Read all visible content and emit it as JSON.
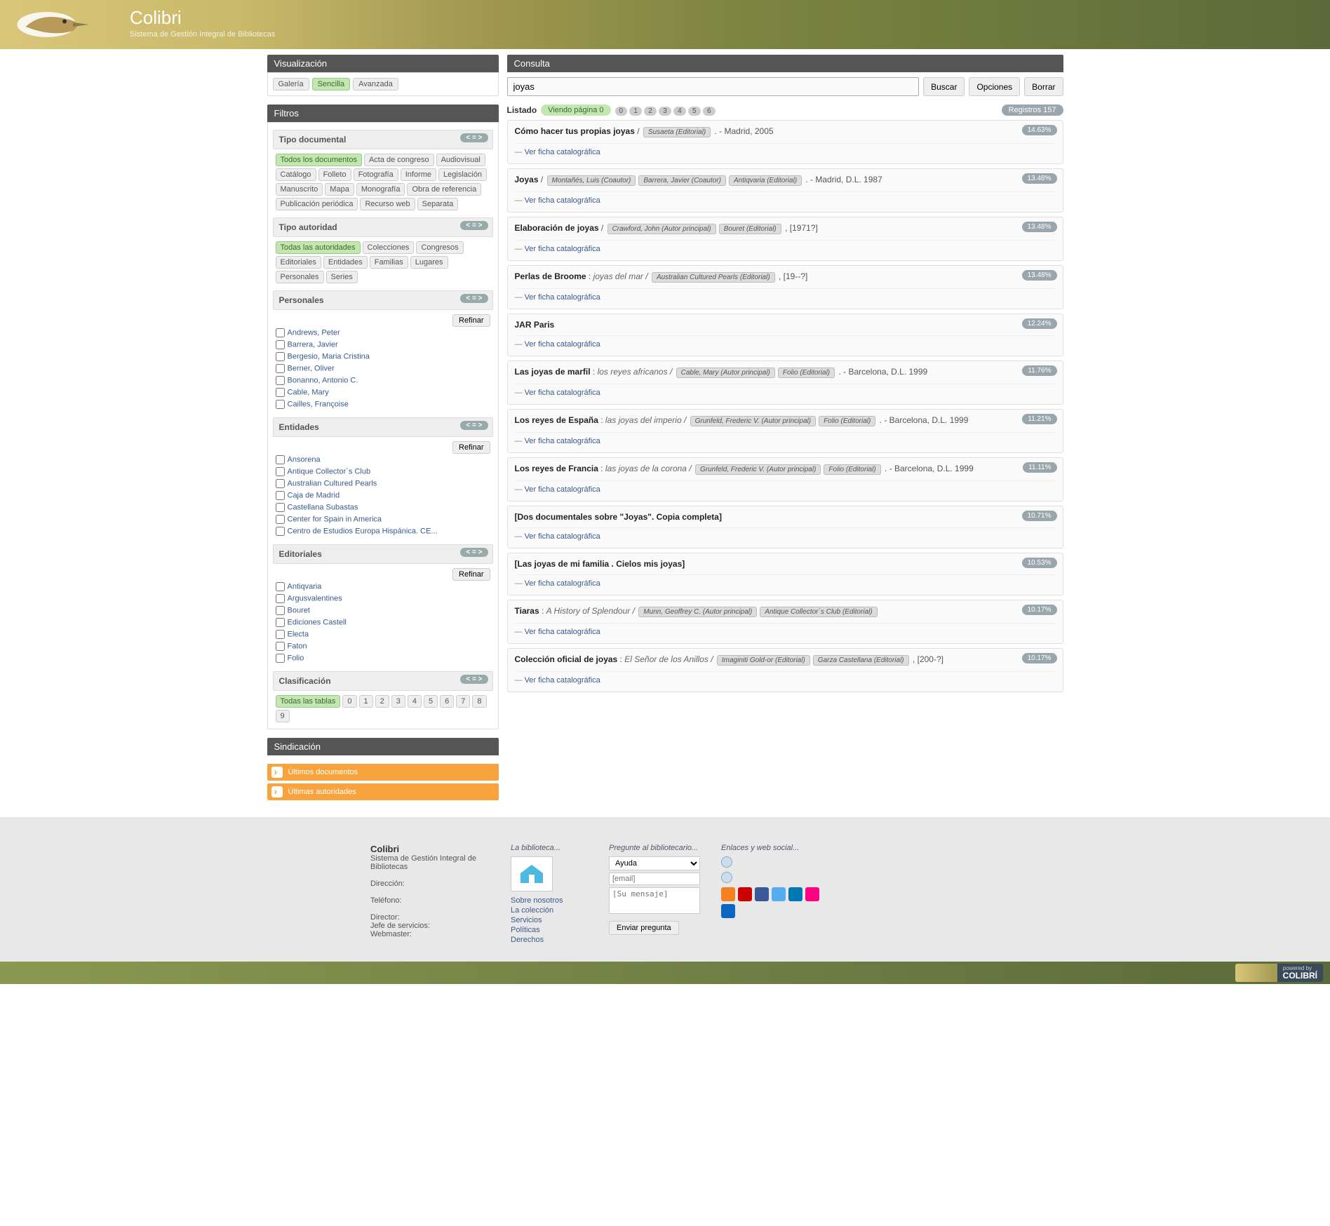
{
  "header": {
    "title": "Colibri",
    "subtitle": "Sistema de Gestión Integral de Bibliotecas"
  },
  "sidebar": {
    "viz": {
      "title": "Visualización",
      "modes": [
        {
          "label": "Galería",
          "active": false
        },
        {
          "label": "Sencilla",
          "active": true
        },
        {
          "label": "Avanzada",
          "active": false
        }
      ]
    },
    "filters_title": "Filtros",
    "doc_type": {
      "title": "Tipo documental",
      "items": [
        {
          "label": "Todos los documentos",
          "active": true
        },
        {
          "label": "Acta de congreso"
        },
        {
          "label": "Audiovisual"
        },
        {
          "label": "Catálogo"
        },
        {
          "label": "Folleto"
        },
        {
          "label": "Fotografía"
        },
        {
          "label": "Informe"
        },
        {
          "label": "Legislación"
        },
        {
          "label": "Manuscrito"
        },
        {
          "label": "Mapa"
        },
        {
          "label": "Monografía"
        },
        {
          "label": "Obra de referencia"
        },
        {
          "label": "Publicación periódica"
        },
        {
          "label": "Recurso web"
        },
        {
          "label": "Separata"
        }
      ]
    },
    "auth_type": {
      "title": "Tipo autoridad",
      "items": [
        {
          "label": "Todas las autoridades",
          "active": true
        },
        {
          "label": "Colecciones"
        },
        {
          "label": "Congresos"
        },
        {
          "label": "Editoriales"
        },
        {
          "label": "Entidades"
        },
        {
          "label": "Familias"
        },
        {
          "label": "Lugares"
        },
        {
          "label": "Personales"
        },
        {
          "label": "Series"
        }
      ]
    },
    "personales": {
      "title": "Personales",
      "refine": "Refinar",
      "items": [
        "Andrews, Peter",
        "Barrera, Javier",
        "Bergesio, Maria Cristina",
        "Berner, Oliver",
        "Bonanno, Antonio C.",
        "Cable, Mary",
        "Cailles, Françoise"
      ]
    },
    "entidades": {
      "title": "Entidades",
      "refine": "Refinar",
      "items": [
        "Ansorena",
        "Antique Collector´s Club",
        "Australian Cultured Pearls",
        "Caja de Madrid",
        "Castellana Subastas",
        "Center for Spain in America",
        "Centro de Estudios Europa Hispánica. CE..."
      ]
    },
    "editoriales": {
      "title": "Editoriales",
      "refine": "Refinar",
      "items": [
        "Antiqvaria",
        "Argusvalentines",
        "Bouret",
        "Ediciones Castell",
        "Electa",
        "Faton",
        "Folio"
      ]
    },
    "clasif": {
      "title": "Clasificación",
      "items": [
        {
          "label": "Todas las tablas",
          "active": true
        },
        {
          "label": "0"
        },
        {
          "label": "1"
        },
        {
          "label": "2"
        },
        {
          "label": "3"
        },
        {
          "label": "4"
        },
        {
          "label": "5"
        },
        {
          "label": "6"
        },
        {
          "label": "7"
        },
        {
          "label": "8"
        },
        {
          "label": "9"
        }
      ]
    },
    "synd": {
      "title": "Sindicación",
      "links": [
        "Últimos documentos",
        "Últimas autoridades"
      ]
    }
  },
  "main": {
    "title": "Consulta",
    "query": "joyas",
    "btn_search": "Buscar",
    "btn_options": "Opciones",
    "btn_clear": "Borrar",
    "list_label": "Listado",
    "viewing": "Viendo página 0",
    "pages": [
      "0",
      "1",
      "2",
      "3",
      "4",
      "5",
      "6"
    ],
    "total_label": "Registros 157",
    "link_label": "Ver ficha catalográfica",
    "results": [
      {
        "pct": "14.63%",
        "title": "Cómo hacer tus propias joyas",
        "sep": " / ",
        "auth": [
          "Susaeta (Editorial)"
        ],
        "post": " . - Madrid, 2005"
      },
      {
        "pct": "13.48%",
        "title": "Joyas",
        "sep": " / ",
        "auth": [
          "Montañés, Luis (Coautor)",
          "Barrera, Javier (Coautor)",
          "Antiqvaria (Editorial)"
        ],
        "post": " . - Madrid, D.L. 1987"
      },
      {
        "pct": "13.48%",
        "title": "Elaboración de joyas",
        "sep": " / ",
        "auth": [
          "Crawford, John (Autor principal)",
          "Bouret (Editorial)"
        ],
        "post": " , [1971?]"
      },
      {
        "pct": "13.48%",
        "title": "Perlas de Broome",
        "sep": " : ",
        "sub": "joyas del mar / ",
        "auth": [
          "Australian Cultured Pearls (Editorial)"
        ],
        "post": " , [19--?]"
      },
      {
        "pct": "12.24%",
        "title": "JAR Paris",
        "sep": "",
        "auth": [],
        "post": ""
      },
      {
        "pct": "11.76%",
        "title": "Las joyas de marfil",
        "sep": " : ",
        "sub": "los reyes africanos / ",
        "auth": [
          "Cable, Mary (Autor principal)",
          "Folio (Editorial)"
        ],
        "post": " . - Barcelona, D.L. 1999"
      },
      {
        "pct": "11.21%",
        "title": "Los reyes de España",
        "sep": " : ",
        "sub": "las joyas del imperio / ",
        "auth": [
          "Grunfeld, Frederic V. (Autor principal)",
          "Folio (Editorial)"
        ],
        "post": " . - Barcelona, D.L. 1999"
      },
      {
        "pct": "11.11%",
        "title": "Los reyes de Francia",
        "sep": " : ",
        "sub": "las joyas de la corona / ",
        "auth": [
          "Grunfeld, Frederic V. (Autor principal)",
          "Folio (Editorial)"
        ],
        "post": " . - Barcelona, D.L. 1999"
      },
      {
        "pct": "10.71%",
        "title": "[Dos documentales sobre \"Joyas\". Copia completa]",
        "sep": "",
        "auth": [],
        "post": ""
      },
      {
        "pct": "10.53%",
        "title": "[Las joyas de mi familia . Cielos mis joyas]",
        "sep": "",
        "auth": [],
        "post": ""
      },
      {
        "pct": "10.17%",
        "title": "Tiaras",
        "sep": " : ",
        "sub": "A History of Splendour / ",
        "auth": [
          "Munn, Geoffrey C. (Autor principal)",
          "Antique Collector´s Club (Editorial)"
        ],
        "post": ""
      },
      {
        "pct": "10.17%",
        "title": "Colección oficial de joyas",
        "sep": " : ",
        "sub": "El Señor de los Anillos / ",
        "auth": [
          "Imaginiti Gold-or (Editorial)",
          "Garza Castellana (Editorial)"
        ],
        "post": " , [200-?]"
      }
    ]
  },
  "footer": {
    "about": {
      "name": "Colibri",
      "sub": "Sistema de Gestión Integral de Bibliotecas",
      "addr": "Dirección:",
      "tel": "Teléfono:",
      "dir": "Director:",
      "jefe": "Jefe de servicios:",
      "web": "Webmaster:"
    },
    "lib": {
      "title": "La biblioteca...",
      "links": [
        "Sobre nosotros",
        "La colección",
        "Servicios",
        "Políticas",
        "Derechos"
      ]
    },
    "ask": {
      "title": "Pregunte al bibliotecario...",
      "type": "Ayuda",
      "email_ph": "[email]",
      "msg_ph": "[Su mensaje]",
      "btn": "Enviar pregunta"
    },
    "links": {
      "title": "Enlaces y web social...",
      "social": [
        "#f58220",
        "#c00",
        "#3b5998",
        "#55acee",
        "#0077b5",
        "#ff0084",
        "#0a66c2"
      ]
    },
    "powered": {
      "pre": "powered by",
      "name": "COLIBRÍ"
    }
  }
}
